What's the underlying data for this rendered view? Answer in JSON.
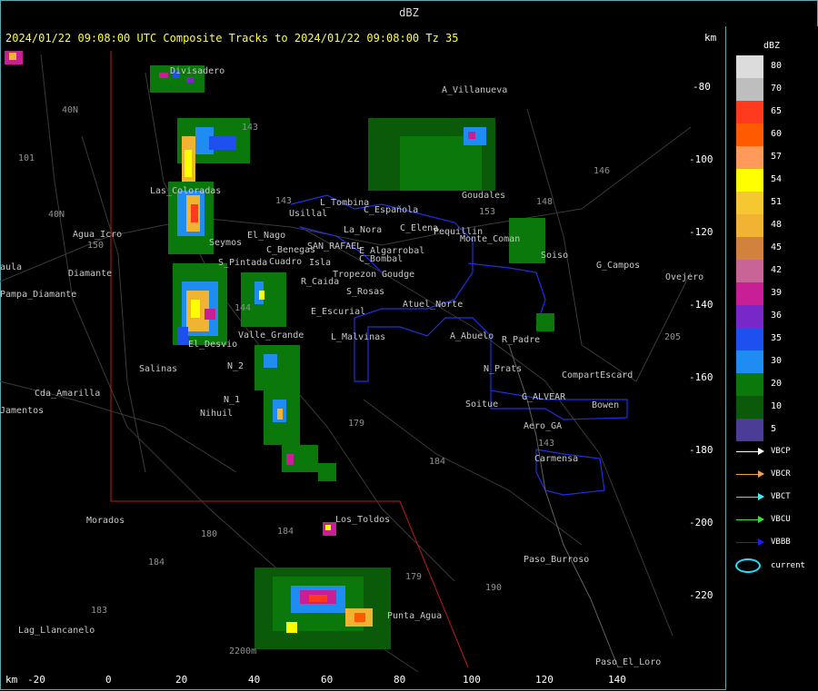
{
  "window": {
    "title": "dBZ"
  },
  "map": {
    "title": "2024/01/22 09:08:00 UTC Composite Tracks to 2024/01/22 09:08:00 Tz 35",
    "km_top": "km",
    "km_bottom": "km",
    "y_ticks": [
      "-80",
      "-100",
      "-120",
      "-140",
      "-160",
      "-180",
      "-200",
      "-220"
    ],
    "x_ticks": [
      "-20",
      "0",
      "20",
      "40",
      "60",
      "80",
      "100",
      "120",
      "140"
    ],
    "places": [
      "Divisadero",
      "A_Villanueva",
      "Usillal",
      "L_Tombina",
      "C_Española",
      "La_Nora",
      "C_Elena",
      "Pequillin",
      "Las_Coloradas",
      "Agua_Icro",
      "Goudales",
      "C_Benegas",
      "SAN_RAFAEL",
      "E_Algarrobal",
      "C_Bombal",
      "El_Nago",
      "Seymos",
      "S_Pintada",
      "Cuadro",
      "Isla",
      "Tropezon",
      "Goudge",
      "R_Caida",
      "S_Rosas",
      "Monte_Coman",
      "Soiso",
      "G_Campos",
      "Ovejero",
      "Diamante",
      "Pampa_Diamante",
      "Atuel_Norte",
      "E_Escurial",
      "Valle_Grande",
      "L_Malvinas",
      "A_Abuelo",
      "R_Padre",
      "El_Desvio",
      "Salinas",
      "N_Prats",
      "CompartEscard",
      "N_2",
      "N_1",
      "Cda_Amarilla",
      "Bowen",
      "G_ALVEAR",
      "Nihuil",
      "Soitue",
      "Aero_GA",
      "Carmensa",
      "Los_Toldos",
      "Morados",
      "Paso_Burroso",
      "Punta_Agua",
      "Lag_Llancanelo",
      "Paso_El_Loro",
      "Jamentos",
      "aula"
    ],
    "route_numbers": [
      "40N",
      "40N",
      "101",
      "143",
      "146",
      "148",
      "143",
      "153",
      "144",
      "179",
      "184",
      "150",
      "180",
      "184",
      "183",
      "184",
      "179",
      "190",
      "143",
      "205",
      "2200m"
    ]
  },
  "legend": {
    "title": "dBZ",
    "scale": [
      {
        "label": "80",
        "color": "#dcdcdc"
      },
      {
        "label": "70",
        "color": "#bebebe"
      },
      {
        "label": "65",
        "color": "#ff3a1e"
      },
      {
        "label": "60",
        "color": "#ff5a00"
      },
      {
        "label": "57",
        "color": "#ff9a5a"
      },
      {
        "label": "54",
        "color": "#ffff00"
      },
      {
        "label": "51",
        "color": "#f5c832"
      },
      {
        "label": "48",
        "color": "#f0b432"
      },
      {
        "label": "45",
        "color": "#d2823c"
      },
      {
        "label": "42",
        "color": "#c86496"
      },
      {
        "label": "39",
        "color": "#c81e96"
      },
      {
        "label": "36",
        "color": "#7828c8"
      },
      {
        "label": "35",
        "color": "#1e50f0"
      },
      {
        "label": "30",
        "color": "#1e8cf0"
      },
      {
        "label": "20",
        "color": "#0a780a"
      },
      {
        "label": "10",
        "color": "#0a5a0a"
      },
      {
        "label": "5",
        "color": "#4b3c96"
      }
    ],
    "tracks": [
      {
        "label": "VBCP",
        "color": "#ffffff"
      },
      {
        "label": "VBCR",
        "color": "#f0a050"
      },
      {
        "label": "VBCT",
        "color": "#3cf0f0"
      },
      {
        "label": "VBCU",
        "color": "#3cdc3c"
      },
      {
        "label": "VBBB",
        "color": "#1e1ef0"
      }
    ],
    "current_label": "current"
  }
}
